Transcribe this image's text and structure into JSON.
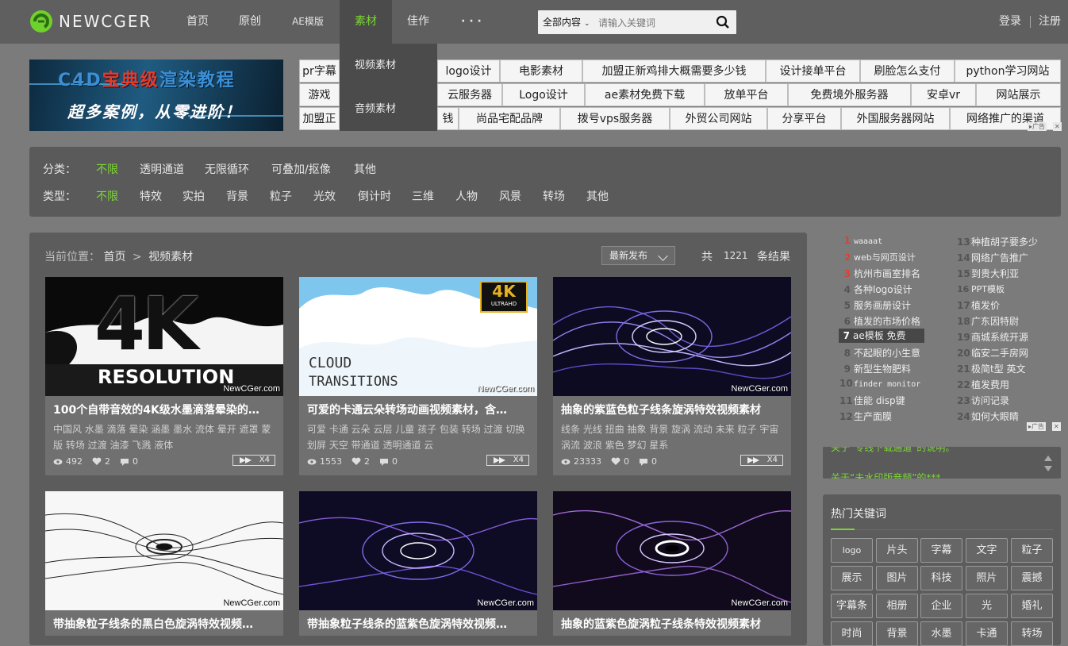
{
  "header": {
    "logo_text": "NEWCGER",
    "nav": [
      "首页",
      "原创",
      "AE模版",
      "素材",
      "佳作",
      "· · ·"
    ],
    "active_nav": "素材",
    "dropdown": [
      "视频素材",
      "音频素材"
    ],
    "search": {
      "category": "全部内容",
      "placeholder": "请输入关键词"
    },
    "login": "登录",
    "register": "注册"
  },
  "banner": {
    "line1_a": "C4D",
    "line1_b": "宝典级",
    "line1_c": "渲染教程",
    "line2": "超多案例，从零进阶！"
  },
  "ad_rows": [
    [
      "pr字幕",
      "logo设计",
      "电影素材",
      "加盟正新鸡排大概需要多少钱",
      "设计接单平台",
      "刷脸怎么支付",
      "python学习网站"
    ],
    [
      "游戏",
      "云服务器",
      "Logo设计",
      "ae素材免费下载",
      "放单平台",
      "免费境外服务器",
      "安卓vr",
      "网站展示"
    ],
    [
      "加盟正",
      "钱",
      "尚品宅配品牌",
      "拨号vps服务器",
      "外贸公司网站",
      "分享平台",
      "外国服务器网站",
      "网络推广的渠道"
    ]
  ],
  "ad_tag": "广告",
  "filters": {
    "category_label": "分类：",
    "category_options": [
      "不限",
      "透明通道",
      "无限循环",
      "可叠加/抠像",
      "其他"
    ],
    "type_label": "类型：",
    "type_options": [
      "不限",
      "特效",
      "实拍",
      "背景",
      "粒子",
      "光效",
      "倒计时",
      "三维",
      "人物",
      "风景",
      "转场",
      "其他"
    ]
  },
  "breadcrumb": {
    "prefix": "当前位置：",
    "home": "首页",
    "sep": ">",
    "current": "视频素材"
  },
  "sort": {
    "selected": "最新发布"
  },
  "results": {
    "prefix": "共",
    "count": "1221",
    "suffix": "条结果"
  },
  "cards": [
    {
      "title": "100个自带音效的4K级水墨滴落晕染的…",
      "tags": "中国风 水墨 滴落 晕染 涵墨 墨水 流体 晕开 遮罩 蒙版 转场 过渡 油漆 飞溅 液体",
      "views": "492",
      "likes": "2",
      "comments": "0",
      "badge": "X4",
      "watermark": "NewCGer.com"
    },
    {
      "title": "可爱的卡通云朵转场动画视频素材，含…",
      "tags": "可爱 卡通 云朵 云层 儿童 孩子 包装 转场 过渡 切换 划屏 天空 带通道 透明通道 云",
      "views": "1553",
      "likes": "2",
      "comments": "0",
      "badge": "X4",
      "watermark": "NewCGer.com"
    },
    {
      "title": "抽象的紫蓝色粒子线条旋涡特效视频素材",
      "tags": "线条 光线 扭曲 抽象 背景 旋涡 流动 未来 粒子 宇宙 涡流 波浪 紫色 梦幻 星系",
      "views": "23333",
      "likes": "0",
      "comments": "0",
      "badge": "X4",
      "watermark": "NewCGer.com"
    },
    {
      "title": "带抽象粒子线条的黑白色旋涡特效视频…",
      "watermark": "NewCGer.com"
    },
    {
      "title": "带抽象粒子线条的蓝紫色旋涡特效视频…",
      "watermark": "NewCGer.com"
    },
    {
      "title": "抽象的蓝紫色旋涡粒子线条特效视频素材",
      "watermark": "NewCGer.com"
    }
  ],
  "thumb_text": {
    "big4k": "4K",
    "resolution": "RESOLUTION",
    "cloud1": "CLOUD",
    "cloud2": "TRANSITIONS",
    "uhd1": "4K",
    "uhd2": "ULTRAHD"
  },
  "rank_left": [
    {
      "n": "1",
      "t": "waaaat"
    },
    {
      "n": "2",
      "t": "web与网页设计"
    },
    {
      "n": "3",
      "t": "杭州市画室排名"
    },
    {
      "n": "4",
      "t": "各种logo设计"
    },
    {
      "n": "5",
      "t": "服务画册设计"
    },
    {
      "n": "6",
      "t": "植发的市场价格"
    },
    {
      "n": "7",
      "t": "ae模板 免费"
    },
    {
      "n": "8",
      "t": "不起眼的小生意"
    },
    {
      "n": "9",
      "t": "新型生物肥料"
    },
    {
      "n": "10",
      "t": "finder monitor"
    },
    {
      "n": "11",
      "t": "佳能 disp键"
    },
    {
      "n": "12",
      "t": "生产面膜"
    }
  ],
  "rank_right": [
    {
      "n": "13",
      "t": "种植胡子要多少"
    },
    {
      "n": "14",
      "t": "网络广告推广"
    },
    {
      "n": "15",
      "t": "到贵大利亚"
    },
    {
      "n": "16",
      "t": "PPT模板"
    },
    {
      "n": "17",
      "t": "植发价"
    },
    {
      "n": "18",
      "t": "广东因特尉"
    },
    {
      "n": "19",
      "t": "商城系统开源"
    },
    {
      "n": "20",
      "t": "临安二手房网"
    },
    {
      "n": "21",
      "t": "极简t型 英文"
    },
    {
      "n": "22",
      "t": "植发费用"
    },
    {
      "n": "23",
      "t": "访问记录"
    },
    {
      "n": "24",
      "t": "如何大眼睛"
    }
  ],
  "notice": [
    "关于“专线下载通道”的说明。",
    "关于“未水印版音频”的***"
  ],
  "hot": {
    "heading": "热门关键词",
    "keywords": [
      "logo",
      "片头",
      "字幕",
      "文字",
      "粒子",
      "展示",
      "图片",
      "科技",
      "照片",
      "震撼",
      "字幕条",
      "相册",
      "企业",
      "光",
      "婚礼",
      "时尚",
      "背景",
      "水墨",
      "卡通",
      "转场"
    ]
  },
  "colors": {
    "accent": "#7bd832",
    "rank_top": "#e53d2f",
    "header_bg": "#5f5f5f",
    "page_bg": "#7b7b7b"
  }
}
